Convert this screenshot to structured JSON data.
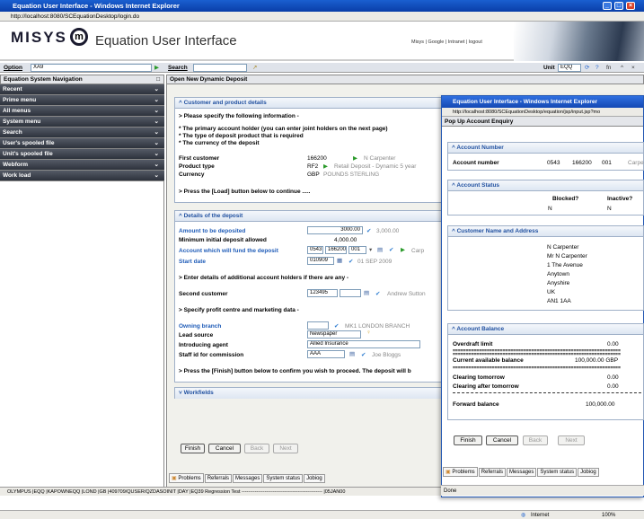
{
  "browser": {
    "title": "Equation User Interface - Windows Internet Explorer",
    "url": "http://localhost:8080/SCEquationDesktop/login.do",
    "status_zone": "Internet",
    "zoom": "100%"
  },
  "banner": {
    "logo": "MISYS",
    "logo_mark": "m",
    "app_title": "Equation User Interface",
    "links": "Misys | Google | Intranet | logout"
  },
  "toolbar": {
    "option_label": "Option",
    "option_value": "XA9",
    "search_label": "Search",
    "unit_label": "Unit",
    "unit_value": "EQQ"
  },
  "nav": {
    "header": "Equation System Navigation",
    "items": [
      {
        "label": "Recent"
      },
      {
        "label": "Prime menu"
      },
      {
        "label": "All menus"
      },
      {
        "label": "System menu"
      },
      {
        "label": "Search"
      },
      {
        "label": "User's spooled file"
      },
      {
        "label": "Unit's spooled file"
      },
      {
        "label": "Webform"
      },
      {
        "label": "Work load"
      }
    ]
  },
  "main": {
    "header": "Open New Dynamic Deposit",
    "customer_section": {
      "title": "Customer and product details",
      "instruction": "> Please specify the following information -",
      "bullets": [
        "* The primary account holder (you can enter joint holders on the next page)",
        "* The type of deposit product that is required",
        "* The currency of the deposit"
      ],
      "first_customer_label": "First customer",
      "first_customer_value": "166200",
      "first_customer_name": "N Carpenter",
      "product_type_label": "Product type",
      "product_type_value": "RF2",
      "product_type_desc": "Retail Deposit - Dynamic 5 year",
      "currency_label": "Currency",
      "currency_value": "GBP",
      "currency_desc": "POUNDS STERLING",
      "load_instruction": "> Press the [Load] button below to continue ....."
    },
    "deposit_section": {
      "title": "Details of the deposit",
      "amount_label": "Amount to be deposited",
      "amount_value": "3000.00",
      "amount_display": "3,000.00",
      "min_deposit_label": "Minimum initial deposit allowed",
      "min_deposit_value": "4,000.00",
      "fund_account_label": "Account which will fund the deposit",
      "fund_account_branch": "0543",
      "fund_account_customer": "166200",
      "fund_account_suffix": "001",
      "fund_account_name": "Carp",
      "start_date_label": "Start date",
      "start_date_value": "010909",
      "start_date_display": "01 SEP 2009",
      "additional_instruction": "> Enter details of additional account holders if there are any -",
      "second_customer_label": "Second customer",
      "second_customer_value": "123495",
      "second_customer_name": "Andrew Sutton",
      "profit_instruction": "> Specify profit centre and marketing data -",
      "owning_branch_label": "Owning branch",
      "owning_branch_display": "MK1 LONDON BRANCH",
      "lead_source_label": "Lead source",
      "lead_source_value": "Newspaper",
      "agent_label": "Introducing agent",
      "agent_value": "Allied Insurance",
      "staff_label": "Staff id for commission",
      "staff_value": "AAA",
      "staff_name": "Joe Bloggs",
      "finish_instruction": "> Press the [Finish] button below to confirm you wish to proceed. The deposit will b"
    },
    "workfields_title": "Workfields",
    "buttons": {
      "finish": "Finish",
      "cancel": "Cancel",
      "back": "Back",
      "next": "Next"
    },
    "tabs": [
      "Problems",
      "Referrals",
      "Messages",
      "System status",
      "Jobiog"
    ]
  },
  "status_bar": "OLYMPUS |EQQ |KAPOWNEQQ |LOND |GB |409709/QUSER/QZDASOINIT |DAY |EQ39 Regression Test ------------------------------------------------- |05JAN00",
  "popup": {
    "title": "Equation User Interface - Windows Internet Explorer",
    "url": "http://localhost:8080/SCEquationDesktop/equation/jsp/input.jsp?mo",
    "header": "Pop Up Account Enquiry",
    "account_number_section": "Account Number",
    "account_number_label": "Account number",
    "account_branch": "0543",
    "account_customer": "166200",
    "account_suffix": "001",
    "account_name": "Carpe",
    "account_status_section": "Account Status",
    "blocked_label": "Blocked?",
    "blocked_value": "N",
    "inactive_label": "Inactive?",
    "inactive_value": "N",
    "customer_section": "Customer Name and Address",
    "address_lines": [
      "N Carpenter",
      "Mr N Carpenter",
      "1 The Avenue",
      "Anytown",
      "Anyshire",
      "UK",
      "AN1 1AA"
    ],
    "balance_section": "Account Balance",
    "overdraft_label": "Overdraft limit",
    "overdraft_value": "0.00",
    "available_label": "Current available balance",
    "available_value": "100,000.00 GBP",
    "clearing_tomorrow_label": "Clearing tomorrow",
    "clearing_tomorrow_value": "0.00",
    "clearing_after_label": "Clearing after tomorrow",
    "clearing_after_value": "0.00",
    "forward_label": "Forward balance",
    "forward_value": "100,000.00",
    "status": "Done",
    "separator": "================================================================"
  }
}
